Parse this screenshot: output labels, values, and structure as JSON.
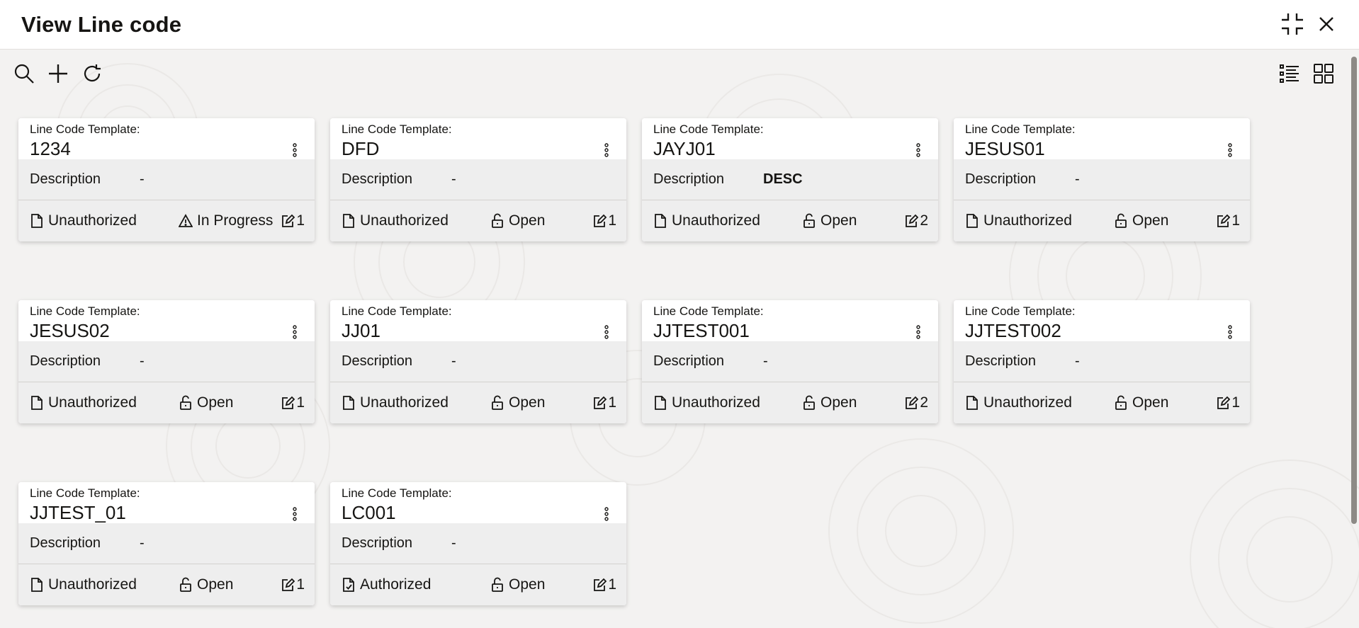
{
  "window": {
    "title": "View Line code"
  },
  "toolbar": {
    "left": [
      "search-icon",
      "add-icon",
      "refresh-icon"
    ],
    "right": [
      "list-view-icon",
      "grid-view-icon"
    ]
  },
  "field_labels": {
    "template": "Line Code Template:",
    "description": "Description"
  },
  "cards": [
    {
      "code": "1234",
      "description": "-",
      "auth_status": "Unauthorized",
      "process_status": "In Progress",
      "mod_count": "1"
    },
    {
      "code": "DFD",
      "description": "-",
      "auth_status": "Unauthorized",
      "process_status": "Open",
      "mod_count": "1"
    },
    {
      "code": "JAYJ01",
      "description": "DESC",
      "auth_status": "Unauthorized",
      "process_status": "Open",
      "mod_count": "2"
    },
    {
      "code": "JESUS01",
      "description": "-",
      "auth_status": "Unauthorized",
      "process_status": "Open",
      "mod_count": "1"
    },
    {
      "code": "JESUS02",
      "description": "-",
      "auth_status": "Unauthorized",
      "process_status": "Open",
      "mod_count": "1"
    },
    {
      "code": "JJ01",
      "description": "-",
      "auth_status": "Unauthorized",
      "process_status": "Open",
      "mod_count": "1"
    },
    {
      "code": "JJTEST001",
      "description": "-",
      "auth_status": "Unauthorized",
      "process_status": "Open",
      "mod_count": "2"
    },
    {
      "code": "JJTEST002",
      "description": "-",
      "auth_status": "Unauthorized",
      "process_status": "Open",
      "mod_count": "1"
    },
    {
      "code": "JJTEST_01",
      "description": "-",
      "auth_status": "Unauthorized",
      "process_status": "Open",
      "mod_count": "1"
    },
    {
      "code": "LC001",
      "description": "-",
      "auth_status": "Authorized",
      "process_status": "Open",
      "mod_count": "1"
    }
  ],
  "colors": {
    "background": "#f3f2f1",
    "card": "#ffffff",
    "card_band": "#eeeeee",
    "text": "#161513"
  }
}
